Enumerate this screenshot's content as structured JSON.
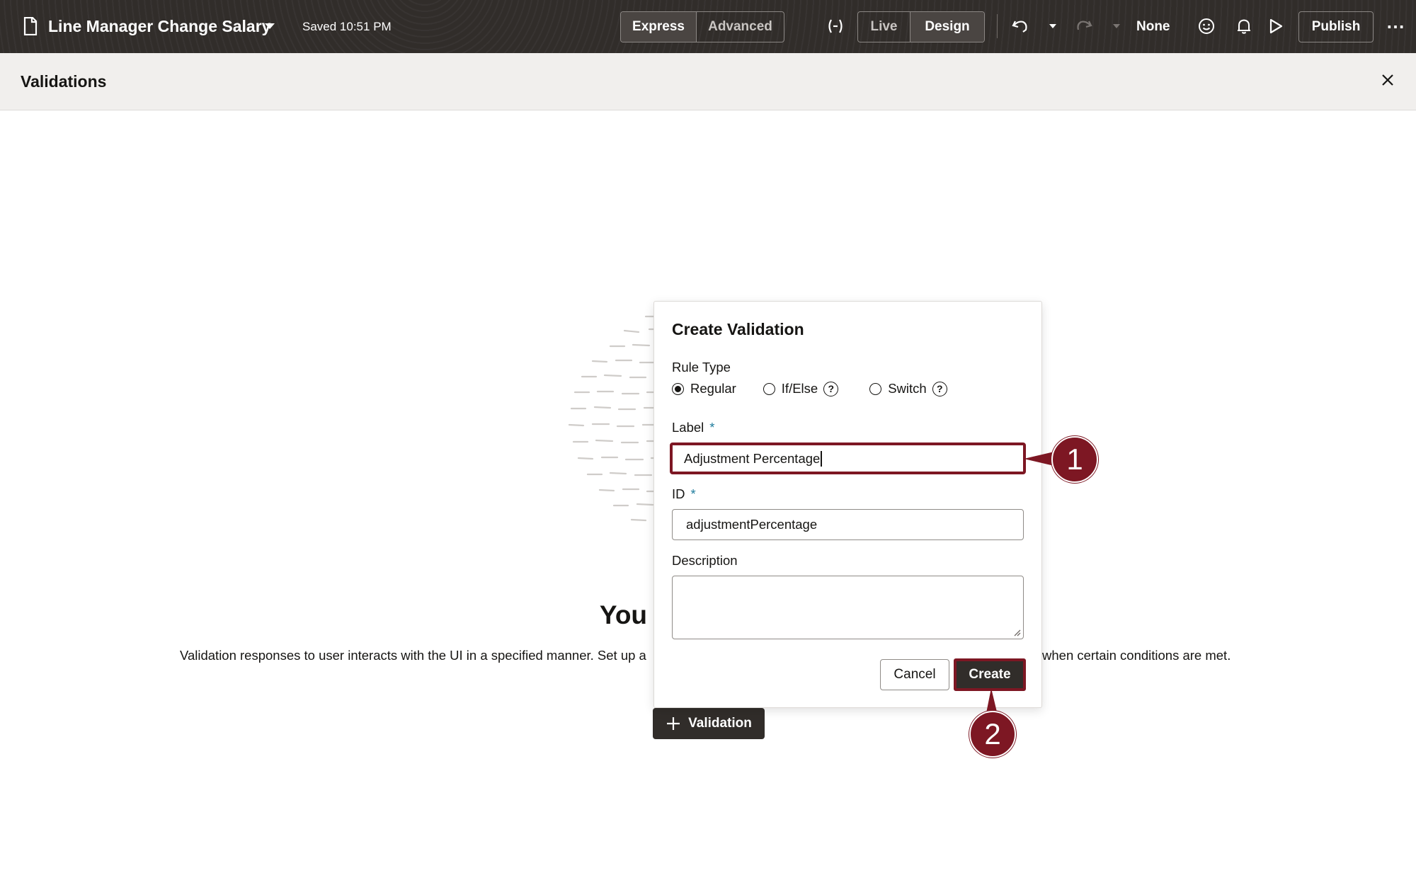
{
  "topbar": {
    "title": "Line Manager Change Salary",
    "saved_status": "Saved 10:51 PM",
    "mode_tabs": [
      "Express",
      "Advanced"
    ],
    "mode_selected": "Express",
    "view_tabs": [
      "Live",
      "Design"
    ],
    "view_selected": "Design",
    "variable_icon_label": "(·)",
    "version_label": "None",
    "publish_label": "Publish",
    "more_label": "⋯"
  },
  "panel": {
    "title": "Validations",
    "close_label": "✕"
  },
  "empty_state": {
    "title": "You don't have ar",
    "description_left": "Validation responses to user interacts with the UI in a specified manner. Set up a",
    "description_right": "when certain conditions are met.",
    "add_button_label": "Validation"
  },
  "dialog": {
    "title": "Create Validation",
    "rule_type_label": "Rule Type",
    "rule_types": [
      "Regular",
      "If/Else",
      "Switch"
    ],
    "rule_type_selected": "Regular",
    "label_field_label": "Label",
    "label_value": "Adjustment Percentage",
    "id_field_label": "ID",
    "id_value": "adjustmentPercentage",
    "description_label": "Description",
    "description_value": "",
    "required_mark": "*",
    "cancel_label": "Cancel",
    "create_label": "Create"
  },
  "callouts": [
    "1",
    "2"
  ],
  "colors": {
    "topbar_bg": "#312d2a",
    "callout": "#7d1723",
    "required": "#227e9e",
    "header_bg": "#f1efed"
  }
}
